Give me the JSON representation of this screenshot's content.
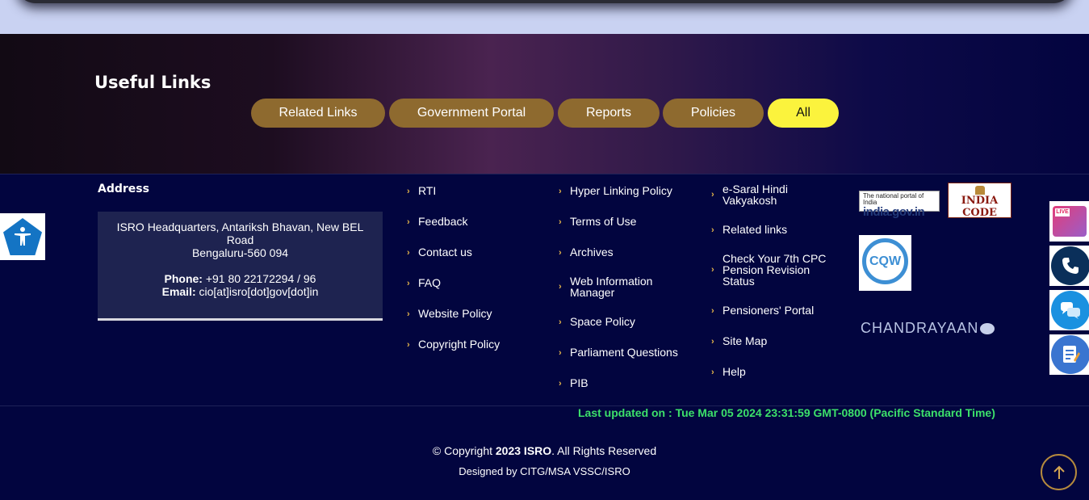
{
  "useful_links": {
    "title": "Useful Links",
    "tabs": [
      {
        "label": "Related Links"
      },
      {
        "label": "Government Portal"
      },
      {
        "label": "Reports"
      },
      {
        "label": "Policies"
      },
      {
        "label": "All",
        "active": true
      }
    ]
  },
  "address": {
    "heading": "Address",
    "line1": "ISRO Headquarters, Antariksh Bhavan, New BEL Road",
    "line2": "Bengaluru-560 094",
    "phone_label": "Phone:",
    "phone": " +91 80 22172294 / 96",
    "email_label": "Email:",
    "email": " cio[at]isro[dot]gov[dot]in"
  },
  "links": {
    "col1": [
      "RTI",
      "Feedback",
      "Contact us",
      "FAQ",
      "Website Policy",
      "Copyright Policy"
    ],
    "col2": [
      "Hyper Linking Policy",
      "Terms of Use",
      "Archives",
      "Web Information Manager",
      "Space Policy",
      "Parliament Questions",
      "PIB"
    ],
    "col3": [
      "e-Saral Hindi Vakyakosh",
      "Related links",
      "Check Your 7th CPC Pension Revision Status",
      "Pensioners' Portal",
      "Site Map",
      "Help"
    ]
  },
  "logos": {
    "india_gov_tagline": "The national portal of India",
    "india_gov": "india.gov.in",
    "india_code": "INDIA CODE",
    "cqw": "CQW",
    "chandrayaan": "CHANDRAYAAN"
  },
  "footer": {
    "last_updated_label": "Last updated on : ",
    "last_updated": "Tue Mar 05 2024 23:31:59 GMT-0800 (Pacific Standard Time)",
    "copyright_prefix": "© Copyright ",
    "copyright_bold": "2023 ISRO",
    "copyright_suffix": ". All Rights Reserved",
    "designed_by": "Designed by CITG/MSA VSSC/ISRO"
  },
  "icons": {
    "accessibility": "accessibility-icon",
    "phone": "phone-icon",
    "chat": "chat-icon",
    "form": "form-icon",
    "back_to_top": "arrow-up-icon"
  },
  "colors": {
    "background": "#02053f",
    "tab": "#8e6a2f",
    "tab_active": "#fbf33d",
    "chevron": "#e6b74a",
    "last_updated": "#3ce06a"
  }
}
